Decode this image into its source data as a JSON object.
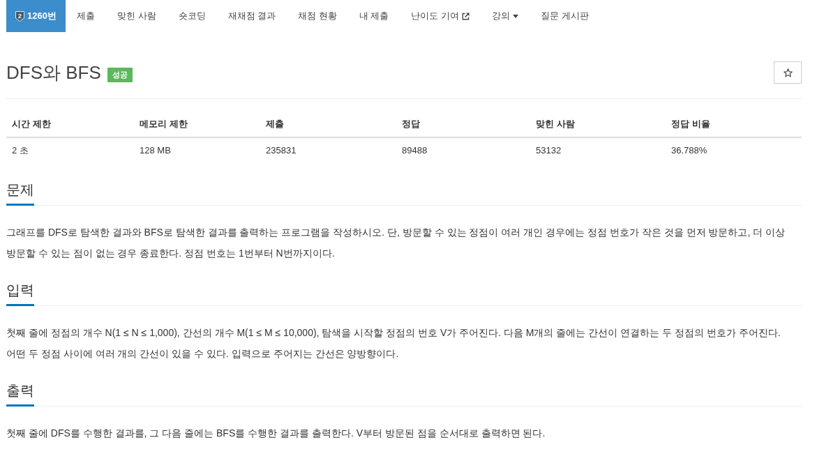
{
  "nav": {
    "items": [
      {
        "label": "1260번",
        "selected": true,
        "kind": "tier",
        "tier_mark": "2"
      },
      {
        "label": "제출",
        "selected": false,
        "kind": "plain"
      },
      {
        "label": "맞힌 사람",
        "selected": false,
        "kind": "plain"
      },
      {
        "label": "숏코딩",
        "selected": false,
        "kind": "plain"
      },
      {
        "label": "재채점 결과",
        "selected": false,
        "kind": "plain"
      },
      {
        "label": "채점 현황",
        "selected": false,
        "kind": "plain"
      },
      {
        "label": "내 제출",
        "selected": false,
        "kind": "plain"
      },
      {
        "label": "난이도 기여",
        "selected": false,
        "kind": "external"
      },
      {
        "label": "강의",
        "selected": false,
        "kind": "dropdown"
      },
      {
        "label": "질문 게시판",
        "selected": false,
        "kind": "plain"
      }
    ]
  },
  "problem": {
    "title": "DFS와 BFS",
    "result_badge": "성공",
    "starred": false
  },
  "info_table": {
    "columns": [
      "시간 제한",
      "메모리 제한",
      "제출",
      "정답",
      "맞힌 사람",
      "정답 비율"
    ],
    "rows": [
      [
        "2 초",
        "128 MB",
        "235831",
        "89488",
        "53132",
        "36.788%"
      ]
    ]
  },
  "sections": [
    {
      "heading": "문제",
      "text": "그래프를 DFS로 탐색한 결과와 BFS로 탐색한 결과를 출력하는 프로그램을 작성하시오. 단, 방문할 수 있는 정점이 여러 개인 경우에는 정점 번호가 작은 것을 먼저 방문하고, 더 이상 방문할 수 있는 점이 없는 경우 종료한다. 정점 번호는 1번부터 N번까지이다."
    },
    {
      "heading": "입력",
      "text": "첫째 줄에 정점의 개수 N(1 ≤ N ≤ 1,000), 간선의 개수 M(1 ≤ M ≤ 10,000), 탐색을 시작할 정점의 번호 V가 주어진다. 다음 M개의 줄에는 간선이 연결하는 두 정점의 번호가 주어진다. 어떤 두 정점 사이에 여러 개의 간선이 있을 수 있다. 입력으로 주어지는 간선은 양방향이다."
    },
    {
      "heading": "출력",
      "text": "첫째 줄에 DFS를 수행한 결과를, 그 다음 줄에는 BFS를 수행한 결과를 출력한다. V부터 방문된 점을 순서대로 출력하면 된다."
    }
  ]
}
